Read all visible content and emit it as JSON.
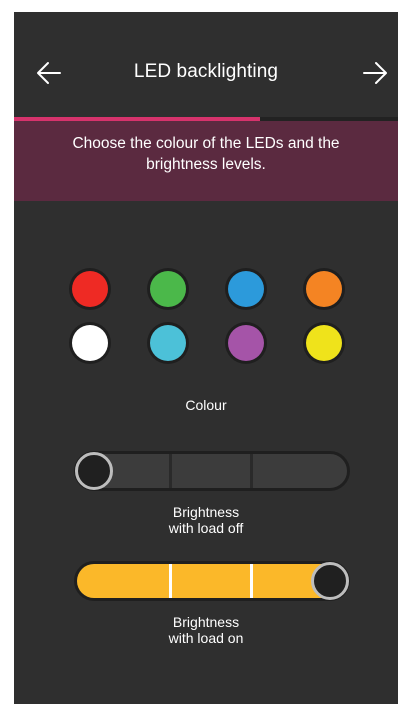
{
  "header": {
    "title": "LED backlighting",
    "back_icon": "arrow-left-icon",
    "next_icon": "arrow-right-icon"
  },
  "progress": {
    "fraction": 0.64,
    "color": "#d6336c"
  },
  "banner": {
    "text": "Choose the colour of the LEDs and the brightness levels."
  },
  "colour_picker": {
    "label": "Colour",
    "swatches": [
      {
        "name": "red",
        "color": "#ee2a24"
      },
      {
        "name": "green",
        "color": "#4bb84a"
      },
      {
        "name": "blue",
        "color": "#2c9adb"
      },
      {
        "name": "orange",
        "color": "#f48423"
      },
      {
        "name": "white",
        "color": "#ffffff"
      },
      {
        "name": "cyan",
        "color": "#4cc1d8"
      },
      {
        "name": "purple",
        "color": "#a554a8"
      },
      {
        "name": "yellow",
        "color": "#efe31b"
      }
    ]
  },
  "brightness_off": {
    "label_line1": "Brightness",
    "label_line2": "with load off",
    "level": 0
  },
  "brightness_on": {
    "label_line1": "Brightness",
    "label_line2": "with load on",
    "level": 1,
    "color": "#fbb829"
  }
}
